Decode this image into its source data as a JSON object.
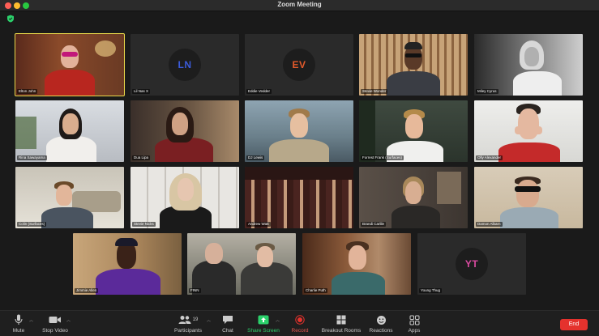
{
  "window": {
    "title": "Zoom Meeting"
  },
  "colors": {
    "accent_green": "#2bd16b",
    "end_red": "#e5322d",
    "active_outline": "#e8d84a"
  },
  "participants": [
    {
      "name": "Elton John",
      "initials": "",
      "active": true
    },
    {
      "name": "Lil Nas X",
      "initials": "LN",
      "initials_color": "#3b5bd9"
    },
    {
      "name": "Eddie Vedder",
      "initials": "EV",
      "initials_color": "#e35a2b"
    },
    {
      "name": "Stevie Wonder",
      "initials": ""
    },
    {
      "name": "Miley Cyrus",
      "initials": ""
    },
    {
      "name": "Rina Sawayama",
      "initials": ""
    },
    {
      "name": "Dua Lipa",
      "initials": ""
    },
    {
      "name": "DJ Lewis",
      "initials": ""
    },
    {
      "name": "Forrest Frank (Surfaces)",
      "initials": ""
    },
    {
      "name": "Olly Alexander",
      "initials": ""
    },
    {
      "name": "Colin (Surfaces)",
      "initials": ""
    },
    {
      "name": "Stevie Nicks",
      "initials": ""
    },
    {
      "name": "Andrew Watt",
      "initials": ""
    },
    {
      "name": "Brandi Carlile",
      "initials": ""
    },
    {
      "name": "Damon Albarn",
      "initials": ""
    },
    {
      "name": "Jimmie Allen",
      "initials": ""
    },
    {
      "name": "FINN",
      "initials": ""
    },
    {
      "name": "Charlie Puth",
      "initials": ""
    },
    {
      "name": "Young Thug",
      "initials": "YT",
      "initials_color": "#d94aa0"
    }
  ],
  "toolbar": {
    "mute": "Mute",
    "stop_video": "Stop Video",
    "participants": "Participants",
    "participant_count": "19",
    "chat": "Chat",
    "share_screen": "Share Screen",
    "record": "Record",
    "breakout_rooms": "Breakout Rooms",
    "reactions": "Reactions",
    "apps": "Apps",
    "end": "End"
  }
}
